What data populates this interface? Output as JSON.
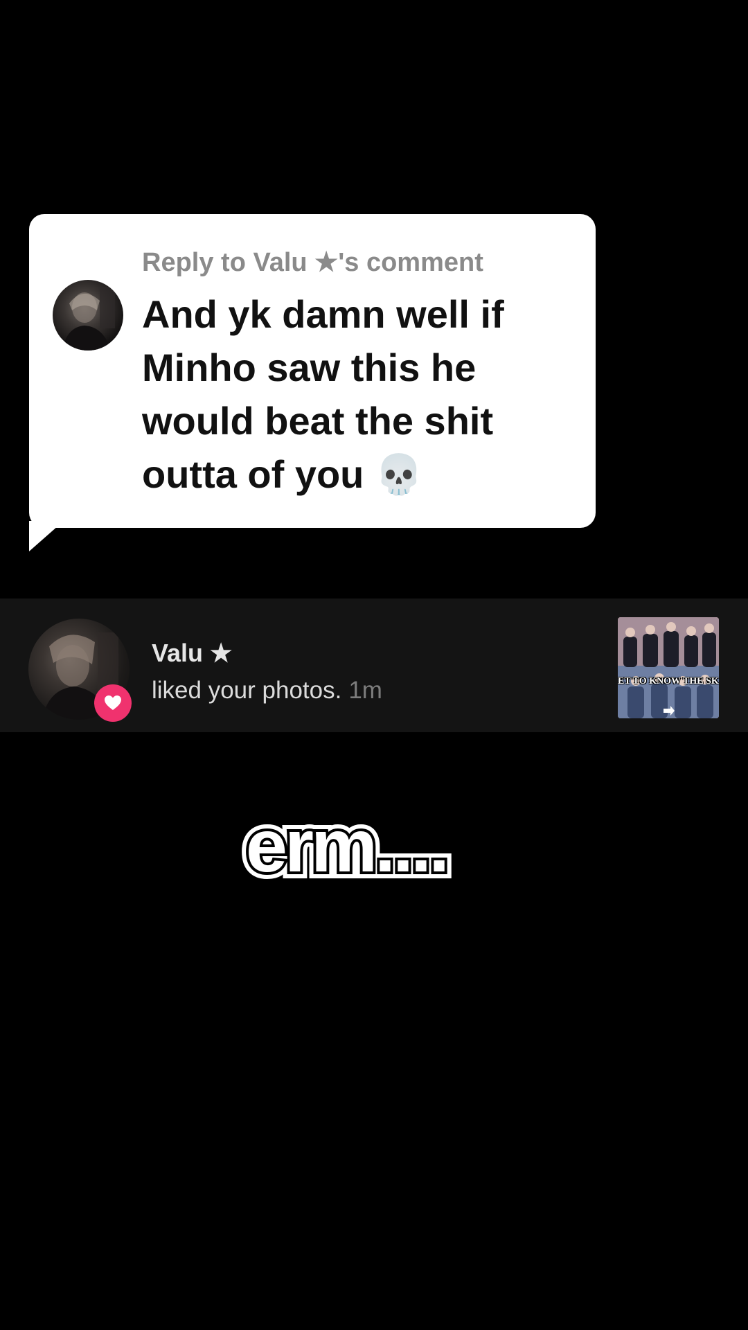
{
  "reply": {
    "header": "Reply to Valu ★'s comment",
    "text": "And yk damn well if Minho saw this he would beat the shit outta of you 💀"
  },
  "notification": {
    "username": "Valu ★",
    "action": "liked your photos.",
    "time": "1m",
    "thumbnail_text": "ET TO KNOW THE SK MBERS!! for new sta",
    "badge_color": "#f0326e",
    "badge_icon": "heart-icon"
  },
  "caption": {
    "text": "erm...."
  }
}
